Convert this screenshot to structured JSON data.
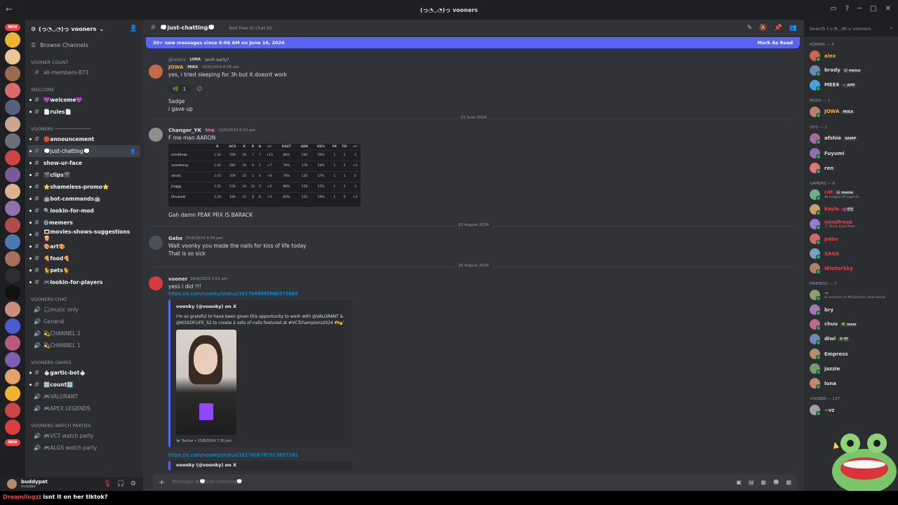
{
  "titlebar": {
    "title": "(っ◔◡◔)っ vooners"
  },
  "sidebar": {
    "guild_name": "(っ◔◡◔)っ vooners",
    "browse": "Browse Channels",
    "groups": [
      {
        "category": "VOONER COUNT",
        "channels": [
          {
            "name": "all-members-873",
            "style": "normal"
          }
        ]
      },
      {
        "category": "WELCOME",
        "channels": [
          {
            "name": "💜welcome💜",
            "style": "unread"
          },
          {
            "name": "📄rules📄",
            "style": "unread"
          }
        ]
      },
      {
        "category": "VOONERS ─────────────",
        "channels": [
          {
            "name": "🔴announcement",
            "style": "unread"
          },
          {
            "name": "💭just-chatting💭",
            "style": "active"
          },
          {
            "name": "show-ur-face",
            "style": "unread"
          },
          {
            "name": "🎬clips🎬",
            "style": "unread"
          },
          {
            "name": "⭐shameless-promo⭐",
            "style": "unread"
          },
          {
            "name": "🤖bot-commands🤖",
            "style": "unread"
          },
          {
            "name": "🔍lookin-for-mod",
            "style": "unread"
          },
          {
            "name": "😆memers",
            "style": "unread"
          },
          {
            "name": "🎞movies-shows-suggestions🍿",
            "style": "unread"
          },
          {
            "name": "🎨art🎨",
            "style": "unread"
          },
          {
            "name": "🍕food🍕",
            "style": "unread"
          },
          {
            "name": "🐈pets🐈",
            "style": "unread"
          },
          {
            "name": "🎮lookin-for-players",
            "style": "unread"
          }
        ]
      },
      {
        "category": "VOONERS CHAT",
        "channels": [
          {
            "name": "🎧music only",
            "style": "voice"
          },
          {
            "name": "General",
            "style": "voice"
          },
          {
            "name": "💫CHANNEL 2",
            "style": "voice"
          },
          {
            "name": "💫CHANNEL 1",
            "style": "voice"
          }
        ]
      },
      {
        "category": "VOONERS GAMES",
        "channels": [
          {
            "name": "🧄gartic-bot🧄",
            "style": "unread"
          },
          {
            "name": "🔢count🔢",
            "style": "unread"
          },
          {
            "name": "🎮VALORANT",
            "style": "voice"
          },
          {
            "name": "🎮APEX LEGENDS",
            "style": "voice"
          }
        ]
      },
      {
        "category": "VOONERS WATCH PARTIES",
        "channels": [
          {
            "name": "🎮VCT watch party",
            "style": "voice"
          },
          {
            "name": "🎮ALGS watch party",
            "style": "voice"
          }
        ]
      }
    ]
  },
  "user": {
    "name": "buddypat",
    "status": "Invisible"
  },
  "twitch_chat": {
    "user": "Dreamlingz",
    "message": ": isnt it on her tiktok?"
  },
  "channel": {
    "name": "💭just-chatting💭",
    "topic": "feel free to chat lol"
  },
  "new_banner": {
    "text": "30+ new messages since 6:06 AM on June 16, 2024",
    "action": "Mark As Read"
  },
  "messages": {
    "m1": {
      "reply_user": "@noémi",
      "reply_tag": "LUNA",
      "reply_text": "work early?",
      "author": "JOWA",
      "tag": "MIKA",
      "time": "16/6/2024 6:06 am",
      "line1": "yes, i tried sleeping for 3h but it doesnt work",
      "reaction_count": "1",
      "line2": "Sadge",
      "line3": "i gave up"
    },
    "d1": "22 June 2024",
    "m2": {
      "author": "Changer_YK",
      "tag": "king",
      "time": "22/6/2024 6:32 pm",
      "line1": "F me man AARON",
      "line2": "Gah damn PEAK PRX IS BARACK"
    },
    "d2": "25 August 2024",
    "m3": {
      "author": "Gabe",
      "time": "25/8/2024 4:09 pm",
      "line1": "Wait voonky you made the nails for kiss of life today",
      "line2": "That is so sick"
    },
    "d3": "26 August 2024",
    "m4": {
      "author": "vooner",
      "time": "26/8/2024 2:03 am",
      "line1": "yess i did !!!",
      "link1": "https://x.com/voonky/status/1827669945880375689",
      "embed_author": "voonky (@voonky) on X",
      "embed_desc": "I'm so grateful to have been given this opportunity to work with @VALORANT & @KISSOFLIFE_S2 to create 2 sets of nails featured at #VCTchampions2024 🫶💅",
      "embed_footer": "Twitter • 25/8/2024 7:30 pm",
      "link2": "https://x.com/voonky/status/1827606767913857182",
      "embed2_author": "voonky (@voonky) on X"
    }
  },
  "scoreboard": {
    "headers": [
      "",
      "R",
      "ACS",
      "K",
      "D",
      "A",
      "+/-",
      "KAST",
      "ADR",
      "HS%",
      "FK",
      "FD",
      "+/-"
    ],
    "rows": [
      [
        "mindfreak",
        "1.32",
        "299",
        "30",
        "7",
        "7",
        "+13",
        "88%",
        "160",
        "30%",
        "1",
        "2",
        "-1"
      ],
      [
        "something",
        "1.41",
        "281",
        "16",
        "6",
        "2",
        "+7",
        "76%",
        "178",
        "34%",
        "1",
        "2",
        "+1"
      ],
      [
        "d4v41",
        "1.03",
        "209",
        "13",
        "5",
        "4",
        "+8",
        "78%",
        "130",
        "27%",
        "1",
        "1",
        "0"
      ],
      [
        "Jinggg",
        "1.21",
        "234",
        "14",
        "12",
        "3",
        "+2",
        "88%",
        "158",
        "15%",
        "1",
        "2",
        "-1"
      ],
      [
        "f0rsakeN",
        "1.20",
        "184",
        "11",
        "8",
        "8",
        "+3",
        "84%",
        "122",
        "19%",
        "1",
        "0",
        "+1"
      ]
    ]
  },
  "input": {
    "placeholder": "Message #💭just-chatting💭"
  },
  "member_search": {
    "placeholder": "Search (っ◔◡◔)っ vooners"
  },
  "member_groups": [
    {
      "title": "ADMINS — 3",
      "members": [
        {
          "name": "alex",
          "color": "#f0b232",
          "tag": "",
          "sub": ""
        },
        {
          "name": "brody",
          "color": "#dbdee1",
          "tag": "😺 meow",
          "sub": ""
        },
        {
          "name": "MEE6",
          "color": "#dbdee1",
          "tag": "✓ APP",
          "sub": ""
        }
      ]
    },
    {
      "title": "MODS — 1",
      "members": [
        {
          "name": "JOWA",
          "color": "#f0b232",
          "tag": "MIKA",
          "sub": ""
        }
      ]
    },
    {
      "title": "VIPS — 3",
      "members": [
        {
          "name": "afshie",
          "color": "#dbdee1",
          "tag": "VAMP",
          "sub": ""
        },
        {
          "name": "Fuyumi",
          "color": "#dbdee1",
          "tag": "",
          "sub": ""
        },
        {
          "name": "ren",
          "color": "#dbdee1",
          "tag": "",
          "sub": ""
        }
      ]
    },
    {
      "title": "gamers — 6",
      "members": [
        {
          "name": "cat",
          "color": "#f23f43",
          "tag": "😺 meow",
          "sub": "🎮 League of Legends"
        },
        {
          "name": "kayla",
          "color": "#f23f43",
          "tag": "💗방방",
          "sub": ""
        },
        {
          "name": "mindfreak",
          "color": "#f23f43",
          "tag": "",
          "sub": "🎵 Black Eyed Peas"
        },
        {
          "name": "pabu",
          "color": "#f23f43",
          "tag": "",
          "sub": ""
        },
        {
          "name": "SAGE",
          "color": "#f23f43",
          "tag": "",
          "sub": ""
        },
        {
          "name": "WinterSky",
          "color": "#f23f43",
          "tag": "",
          "sub": ""
        }
      ]
    },
    {
      "title": "friendly — 7",
      "members": [
        {
          "name": "~",
          "color": "#dbdee1",
          "tag": "",
          "sub": "Hi welcome to McDonald's what would"
        },
        {
          "name": "bry",
          "color": "#dbdee1",
          "tag": "",
          "sub": ""
        },
        {
          "name": "chuu",
          "color": "#dbdee1",
          "tag": "🍀 mew",
          "sub": ""
        },
        {
          "name": "diwi",
          "color": "#dbdee1",
          "tag": "🍀🕊",
          "sub": ""
        },
        {
          "name": "Empress",
          "color": "#dbdee1",
          "tag": "",
          "sub": ""
        },
        {
          "name": "jazzie",
          "color": "#dbdee1",
          "tag": "",
          "sub": ""
        },
        {
          "name": "luna",
          "color": "#dbdee1",
          "tag": "",
          "sub": ""
        }
      ]
    },
    {
      "title": "vooner — 137",
      "members": [
        {
          "name": "~vz",
          "color": "#dbdee1",
          "tag": "",
          "sub": ""
        }
      ]
    }
  ],
  "colors": {
    "blurple": "#5865f2",
    "link": "#00a8fc",
    "online": "#23a55a",
    "mod": "#f0b232",
    "gamer": "#f23f43"
  }
}
